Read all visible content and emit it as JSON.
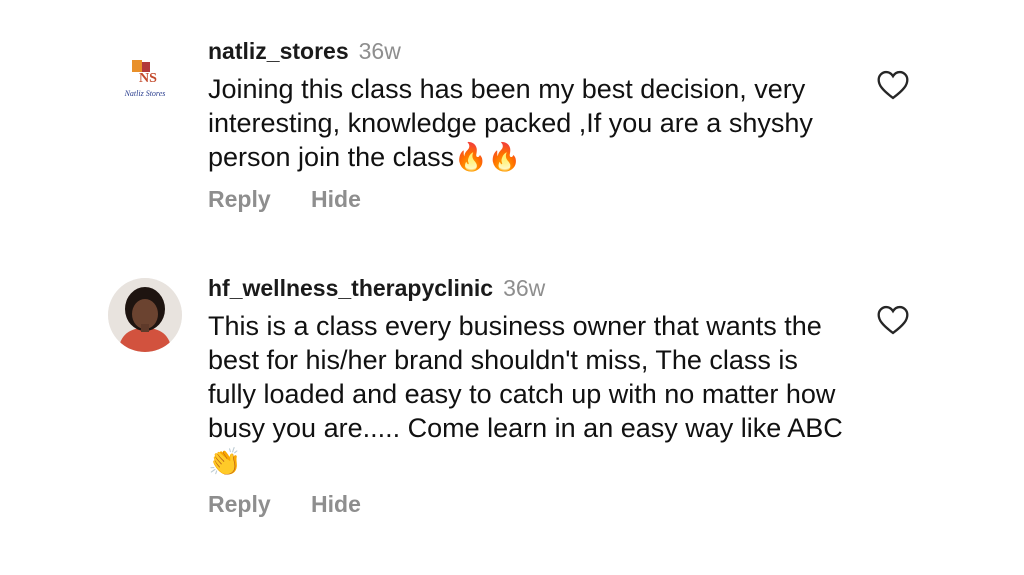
{
  "comments": [
    {
      "username": "natliz_stores",
      "age": "36w",
      "text": "Joining this class has been my best decision, very interesting, knowledge packed ,If you are a shyshy person join the class🔥🔥",
      "reply_label": "Reply",
      "hide_label": "Hide",
      "avatar_logo_initials": "NS",
      "avatar_logo_name": "Natliz Stores"
    },
    {
      "username": "hf_wellness_therapyclinic",
      "age": "36w",
      "text": "This is a class every business owner that wants the best for his/her brand shouldn't miss, The class is fully loaded and easy to catch up with no matter how busy you are..... Come learn in an easy way like ABC👏",
      "reply_label": "Reply",
      "hide_label": "Hide"
    }
  ]
}
